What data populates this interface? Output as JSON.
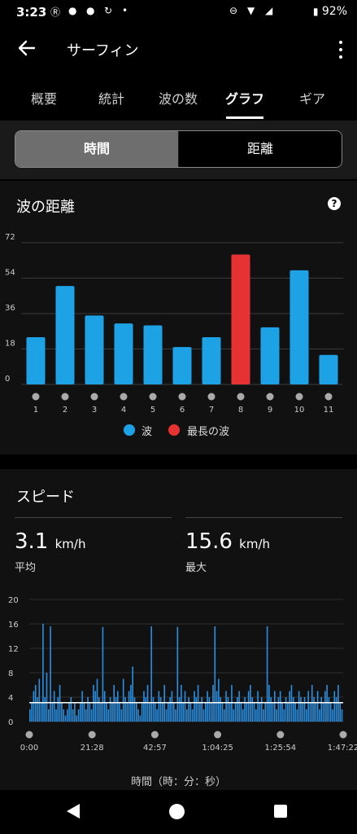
{
  "status": {
    "time": "3:23",
    "battery": "92%",
    "colors": {
      "text": "#ffffff"
    }
  },
  "app_bar": {
    "title": "サーフィン",
    "back_icon": "arrow-left-icon",
    "more_icon": "more-vert-icon"
  },
  "tabs": [
    {
      "label": "概要"
    },
    {
      "label": "統計"
    },
    {
      "label": "波の数"
    },
    {
      "label": "グラフ",
      "active": true
    },
    {
      "label": "ギア"
    }
  ],
  "toggle": {
    "left": "時間",
    "right": "距離",
    "selected": "left"
  },
  "wave_card": {
    "title": "波の距離",
    "help_icon": "help-circle-icon"
  },
  "speed_card": {
    "title": "スピード",
    "avg": {
      "value": "3.1",
      "unit": "km/h",
      "label": "平均"
    },
    "max": {
      "value": "15.6",
      "unit": "km/h",
      "label": "最大"
    },
    "x_axis_label": "時間（時：分：秒）"
  },
  "chart_data": [
    {
      "type": "bar",
      "title": "波の距離",
      "categories": [
        "1",
        "2",
        "3",
        "4",
        "5",
        "6",
        "7",
        "8",
        "9",
        "10",
        "11"
      ],
      "values": [
        24,
        50,
        35,
        31,
        30,
        19,
        24,
        66,
        29,
        58,
        15
      ],
      "highlight_index": 7,
      "y_ticks": [
        0,
        18,
        36,
        54,
        72
      ],
      "ylim": [
        0,
        72
      ],
      "grid": true,
      "legend": [
        {
          "name": "波",
          "color": "#1da2e6"
        },
        {
          "name": "最長の波",
          "color": "#e63232"
        }
      ],
      "legend_position": "bottom"
    },
    {
      "type": "bar",
      "title": "スピード",
      "y_ticks": [
        0,
        4,
        8,
        12,
        16,
        20
      ],
      "ylim": [
        0,
        20
      ],
      "x_ticks": [
        "0:00",
        "21:28",
        "42:57",
        "1:04:25",
        "1:25:54",
        "1:47:22"
      ],
      "average": 3.1,
      "max": 15.6,
      "series": [
        {
          "values": [
            2,
            3,
            5,
            6,
            4,
            7,
            3,
            16,
            4,
            8,
            2,
            15.6,
            3,
            5,
            2,
            4,
            6,
            3,
            2,
            1,
            2,
            3,
            4,
            2,
            3,
            1,
            2,
            3,
            5,
            3,
            2,
            4,
            3,
            2,
            6,
            5,
            7,
            4,
            3,
            15.5,
            5,
            3,
            2,
            4,
            3,
            6,
            4,
            5,
            3,
            2,
            7,
            4,
            3,
            5,
            6,
            9,
            4,
            3,
            2,
            1,
            3,
            5,
            4,
            6,
            3,
            15.6,
            4,
            3,
            2,
            5,
            4,
            3,
            6,
            2,
            3,
            4,
            5,
            3,
            2,
            15.5,
            4,
            6,
            3,
            5,
            2,
            4,
            3,
            2,
            5,
            4,
            6,
            3,
            4,
            2,
            3,
            5,
            4,
            3,
            6,
            15.6,
            5,
            7,
            4,
            3,
            2,
            5,
            4,
            3,
            6,
            2,
            3,
            4,
            5,
            3,
            2,
            4,
            3,
            5,
            6,
            4,
            3,
            2,
            5,
            3,
            4,
            2,
            3,
            15.6,
            6,
            4,
            3,
            5,
            2,
            4,
            5,
            3,
            2,
            4,
            3,
            5,
            6,
            4,
            3,
            2,
            5,
            4,
            3,
            4,
            2,
            5,
            3,
            6,
            4,
            3,
            5,
            2,
            4,
            3,
            5,
            6,
            4,
            3,
            2,
            5,
            4,
            6,
            3,
            2
          ]
        }
      ]
    }
  ]
}
